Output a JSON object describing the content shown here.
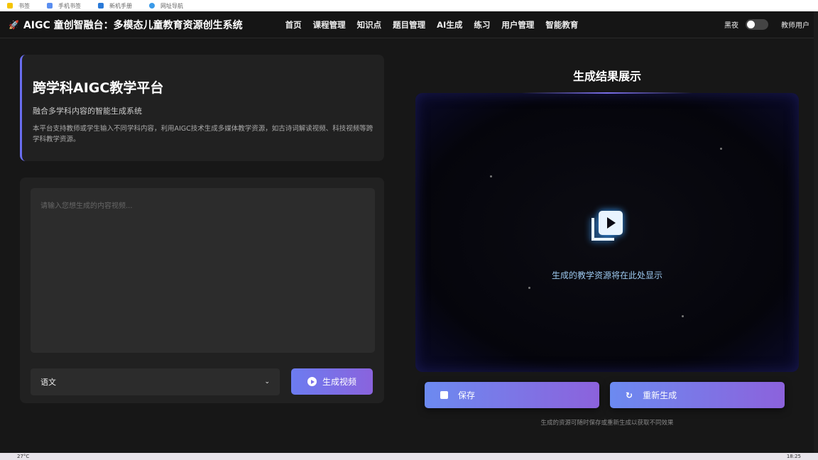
{
  "bookmarks": [
    "书签",
    "手机书签",
    "新机手册",
    "网址导航"
  ],
  "nav": {
    "title": "AIGC 童创智融台：多模态儿童教育资源创生系统",
    "menu": [
      "首页",
      "课程管理",
      "知识点",
      "题目管理",
      "AI生成",
      "练习",
      "用户管理",
      "智能教育"
    ],
    "dark_label": "黑夜",
    "user": "教师用户"
  },
  "intro": {
    "title": "跨学科AIGC教学平台",
    "subtitle": "融合多学科内容的智能生成系统",
    "desc": "本平台支持教师或学生输入不同学科内容，利用AIGC技术生成多媒体教学资源，如古诗词解读视频、科技视频等跨学科教学资源。"
  },
  "form": {
    "placeholder": "请输入您想生成的内容视频...",
    "subject": "语文",
    "generate": "生成视频"
  },
  "result": {
    "title": "生成结果展示",
    "placeholder": "生成的教学资源将在此处显示",
    "save": "保存",
    "regenerate": "重新生成",
    "hint": "生成的资源可随时保存或重新生成以获取不同效果"
  },
  "taskbar": {
    "weather": "27°C",
    "time": "18:25"
  },
  "colors": {
    "accent": "#7a6ee8"
  }
}
